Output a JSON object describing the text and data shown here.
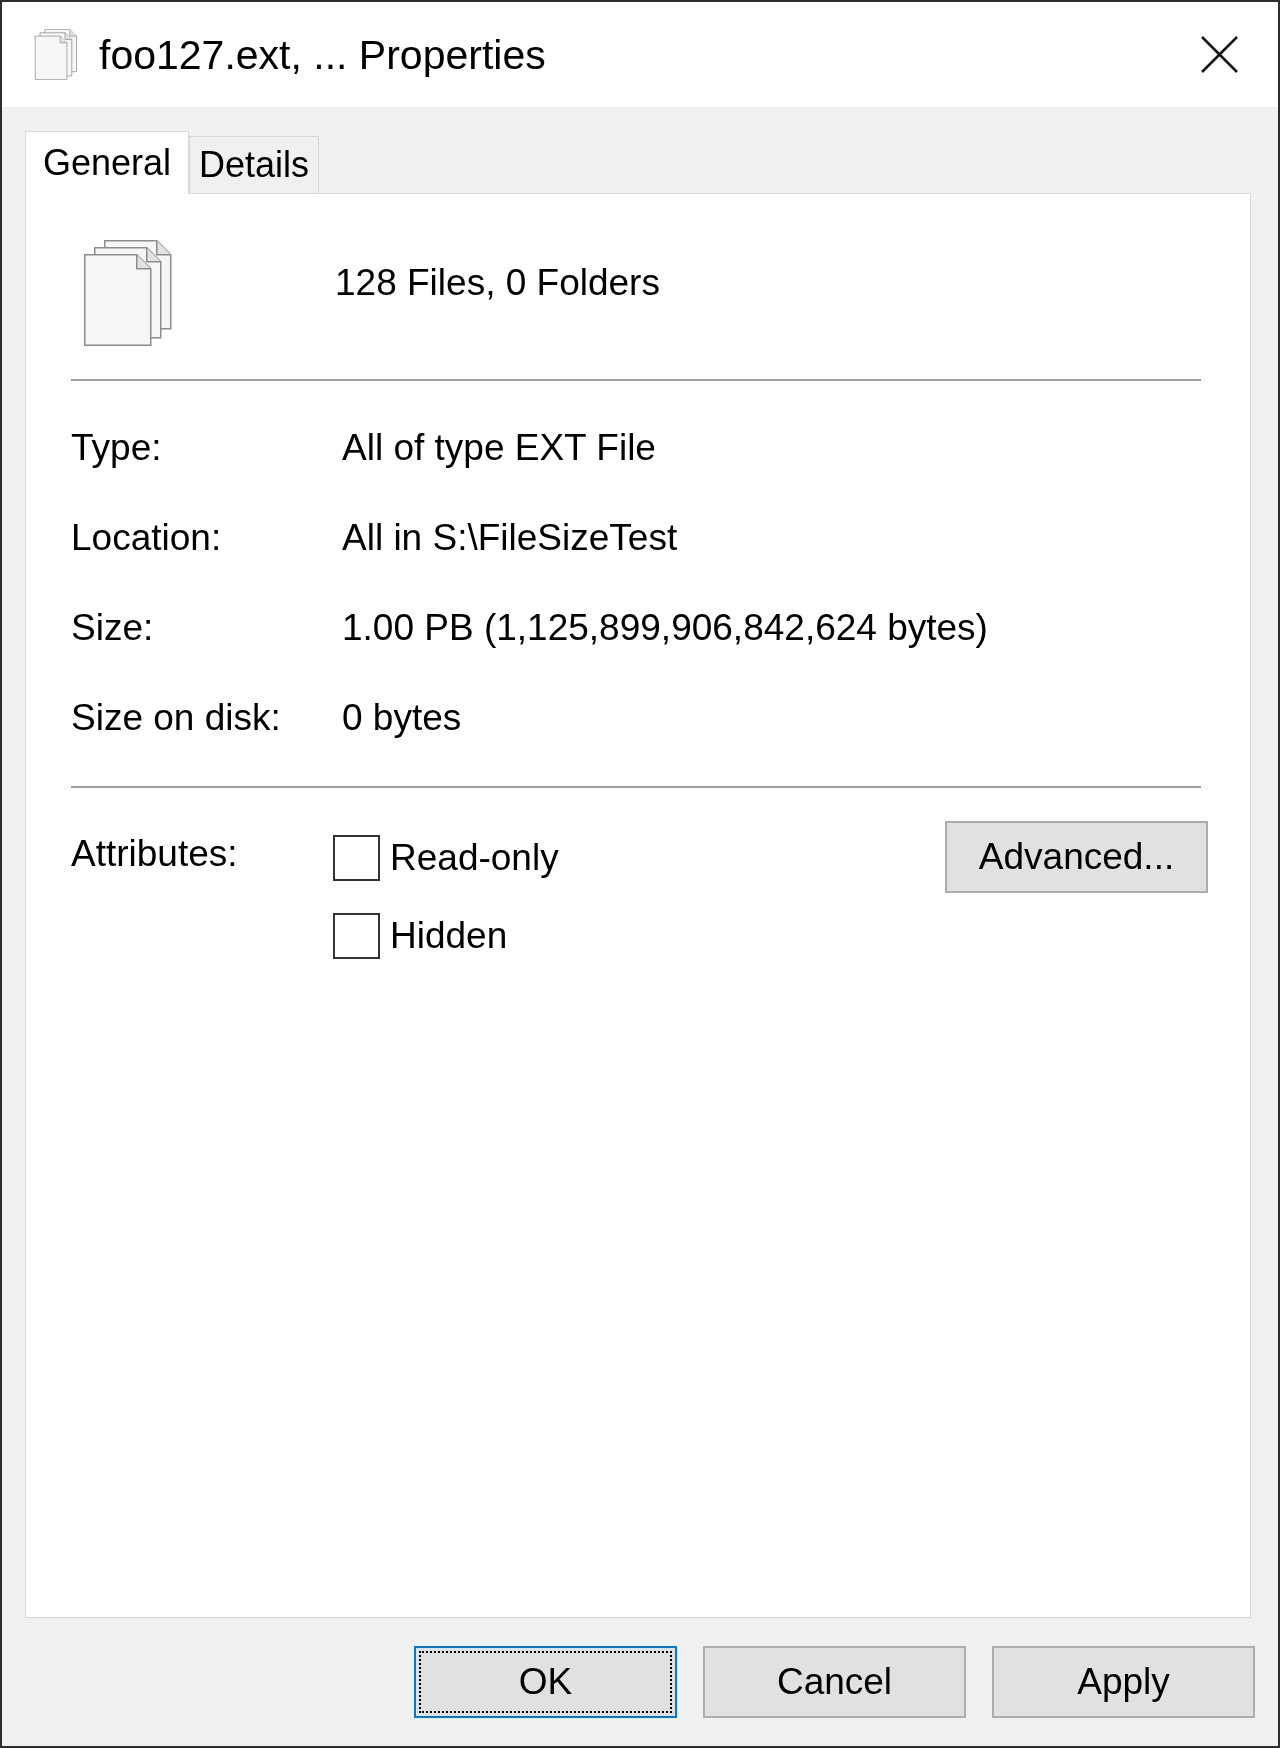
{
  "window": {
    "title": "foo127.ext, ... Properties"
  },
  "tabs": [
    {
      "label": "General",
      "selected": true
    },
    {
      "label": "Details",
      "selected": false
    }
  ],
  "summary": {
    "text": "128 Files, 0 Folders"
  },
  "properties": [
    {
      "label": "Type:",
      "value": "All of type EXT File"
    },
    {
      "label": "Location:",
      "value": "All in S:\\FileSizeTest"
    },
    {
      "label": "Size:",
      "value": "1.00 PB (1,125,899,906,842,624 bytes)"
    },
    {
      "label": "Size on disk:",
      "value": "0 bytes"
    }
  ],
  "attributes": {
    "label": "Attributes:",
    "checkboxes": [
      {
        "label": "Read-only",
        "checked": false
      },
      {
        "label": "Hidden",
        "checked": false
      }
    ],
    "advanced_button": {
      "label": "Advanced..."
    }
  },
  "buttons": [
    {
      "label": "OK",
      "focused": true
    },
    {
      "label": "Cancel",
      "focused": false
    },
    {
      "label": "Apply",
      "focused": false
    }
  ]
}
